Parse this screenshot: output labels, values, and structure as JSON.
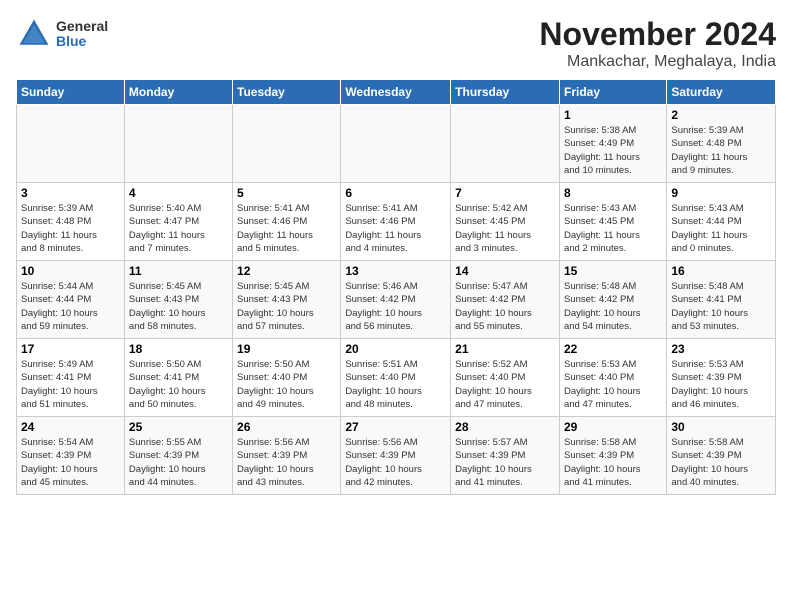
{
  "header": {
    "logo_general": "General",
    "logo_blue": "Blue",
    "month_title": "November 2024",
    "subtitle": "Mankachar, Meghalaya, India"
  },
  "days_of_week": [
    "Sunday",
    "Monday",
    "Tuesday",
    "Wednesday",
    "Thursday",
    "Friday",
    "Saturday"
  ],
  "weeks": [
    [
      {
        "day": "",
        "info": ""
      },
      {
        "day": "",
        "info": ""
      },
      {
        "day": "",
        "info": ""
      },
      {
        "day": "",
        "info": ""
      },
      {
        "day": "",
        "info": ""
      },
      {
        "day": "1",
        "info": "Sunrise: 5:38 AM\nSunset: 4:49 PM\nDaylight: 11 hours\nand 10 minutes."
      },
      {
        "day": "2",
        "info": "Sunrise: 5:39 AM\nSunset: 4:48 PM\nDaylight: 11 hours\nand 9 minutes."
      }
    ],
    [
      {
        "day": "3",
        "info": "Sunrise: 5:39 AM\nSunset: 4:48 PM\nDaylight: 11 hours\nand 8 minutes."
      },
      {
        "day": "4",
        "info": "Sunrise: 5:40 AM\nSunset: 4:47 PM\nDaylight: 11 hours\nand 7 minutes."
      },
      {
        "day": "5",
        "info": "Sunrise: 5:41 AM\nSunset: 4:46 PM\nDaylight: 11 hours\nand 5 minutes."
      },
      {
        "day": "6",
        "info": "Sunrise: 5:41 AM\nSunset: 4:46 PM\nDaylight: 11 hours\nand 4 minutes."
      },
      {
        "day": "7",
        "info": "Sunrise: 5:42 AM\nSunset: 4:45 PM\nDaylight: 11 hours\nand 3 minutes."
      },
      {
        "day": "8",
        "info": "Sunrise: 5:43 AM\nSunset: 4:45 PM\nDaylight: 11 hours\nand 2 minutes."
      },
      {
        "day": "9",
        "info": "Sunrise: 5:43 AM\nSunset: 4:44 PM\nDaylight: 11 hours\nand 0 minutes."
      }
    ],
    [
      {
        "day": "10",
        "info": "Sunrise: 5:44 AM\nSunset: 4:44 PM\nDaylight: 10 hours\nand 59 minutes."
      },
      {
        "day": "11",
        "info": "Sunrise: 5:45 AM\nSunset: 4:43 PM\nDaylight: 10 hours\nand 58 minutes."
      },
      {
        "day": "12",
        "info": "Sunrise: 5:45 AM\nSunset: 4:43 PM\nDaylight: 10 hours\nand 57 minutes."
      },
      {
        "day": "13",
        "info": "Sunrise: 5:46 AM\nSunset: 4:42 PM\nDaylight: 10 hours\nand 56 minutes."
      },
      {
        "day": "14",
        "info": "Sunrise: 5:47 AM\nSunset: 4:42 PM\nDaylight: 10 hours\nand 55 minutes."
      },
      {
        "day": "15",
        "info": "Sunrise: 5:48 AM\nSunset: 4:42 PM\nDaylight: 10 hours\nand 54 minutes."
      },
      {
        "day": "16",
        "info": "Sunrise: 5:48 AM\nSunset: 4:41 PM\nDaylight: 10 hours\nand 53 minutes."
      }
    ],
    [
      {
        "day": "17",
        "info": "Sunrise: 5:49 AM\nSunset: 4:41 PM\nDaylight: 10 hours\nand 51 minutes."
      },
      {
        "day": "18",
        "info": "Sunrise: 5:50 AM\nSunset: 4:41 PM\nDaylight: 10 hours\nand 50 minutes."
      },
      {
        "day": "19",
        "info": "Sunrise: 5:50 AM\nSunset: 4:40 PM\nDaylight: 10 hours\nand 49 minutes."
      },
      {
        "day": "20",
        "info": "Sunrise: 5:51 AM\nSunset: 4:40 PM\nDaylight: 10 hours\nand 48 minutes."
      },
      {
        "day": "21",
        "info": "Sunrise: 5:52 AM\nSunset: 4:40 PM\nDaylight: 10 hours\nand 47 minutes."
      },
      {
        "day": "22",
        "info": "Sunrise: 5:53 AM\nSunset: 4:40 PM\nDaylight: 10 hours\nand 47 minutes."
      },
      {
        "day": "23",
        "info": "Sunrise: 5:53 AM\nSunset: 4:39 PM\nDaylight: 10 hours\nand 46 minutes."
      }
    ],
    [
      {
        "day": "24",
        "info": "Sunrise: 5:54 AM\nSunset: 4:39 PM\nDaylight: 10 hours\nand 45 minutes."
      },
      {
        "day": "25",
        "info": "Sunrise: 5:55 AM\nSunset: 4:39 PM\nDaylight: 10 hours\nand 44 minutes."
      },
      {
        "day": "26",
        "info": "Sunrise: 5:56 AM\nSunset: 4:39 PM\nDaylight: 10 hours\nand 43 minutes."
      },
      {
        "day": "27",
        "info": "Sunrise: 5:56 AM\nSunset: 4:39 PM\nDaylight: 10 hours\nand 42 minutes."
      },
      {
        "day": "28",
        "info": "Sunrise: 5:57 AM\nSunset: 4:39 PM\nDaylight: 10 hours\nand 41 minutes."
      },
      {
        "day": "29",
        "info": "Sunrise: 5:58 AM\nSunset: 4:39 PM\nDaylight: 10 hours\nand 41 minutes."
      },
      {
        "day": "30",
        "info": "Sunrise: 5:58 AM\nSunset: 4:39 PM\nDaylight: 10 hours\nand 40 minutes."
      }
    ]
  ]
}
